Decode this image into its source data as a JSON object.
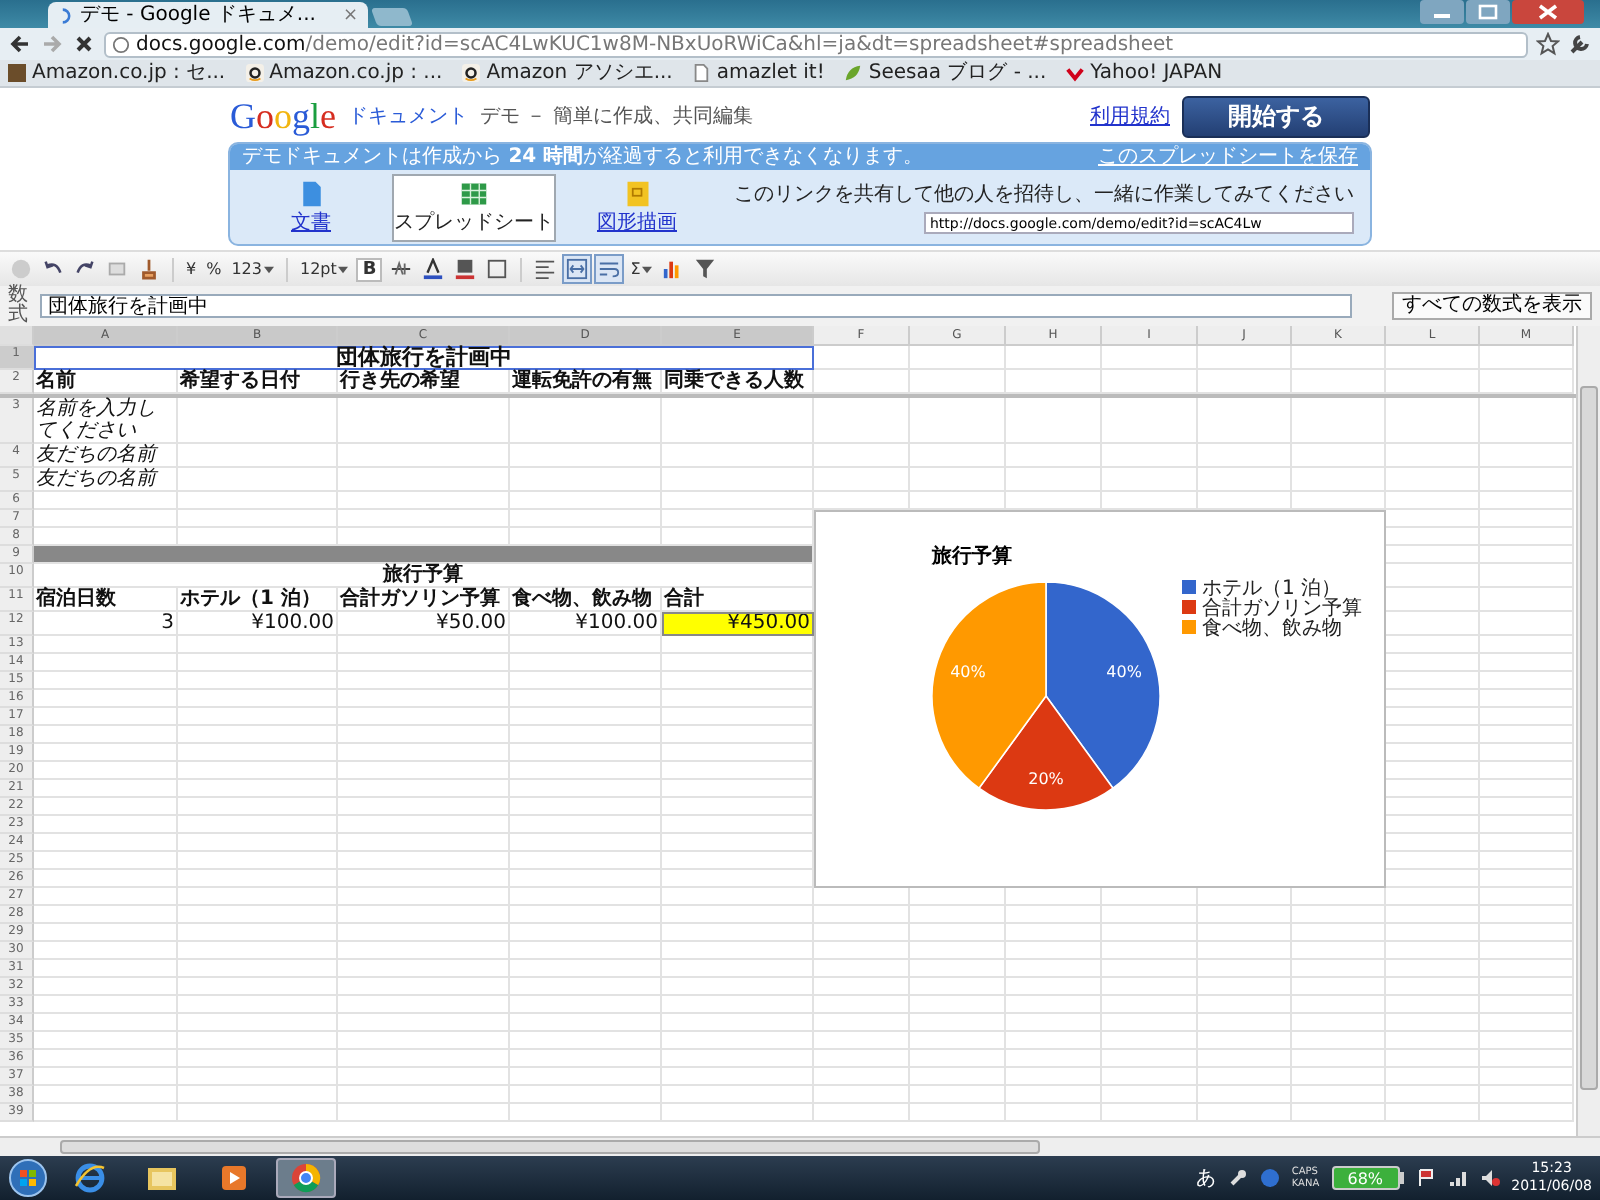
{
  "browser": {
    "tab": {
      "title": "デモ - Google ドキュメ...",
      "close": "×"
    },
    "address": {
      "host": "docs.google.com",
      "path": "/demo/edit?id=scAC4LwKUC1w8M-NBxUoRWiCa&hl=ja&dt=spreadsheet#spreadsheet"
    },
    "bookmarks": [
      {
        "label": "Amazon.co.jp : セ...",
        "kind": "photo"
      },
      {
        "label": "Amazon.co.jp : ...",
        "kind": "amazon"
      },
      {
        "label": "Amazon アソシエ...",
        "kind": "amazon"
      },
      {
        "label": "amazlet it!",
        "kind": "page"
      },
      {
        "label": "Seesaa ブログ - ...",
        "kind": "seesaa"
      },
      {
        "label": "Yahoo! JAPAN",
        "kind": "yahoo"
      }
    ]
  },
  "header": {
    "logo": "Google",
    "product": "ドキュメント",
    "tagline": "デモ － 簡単に作成、共同編集",
    "terms_link": "利用規約",
    "start_button": "開始する",
    "notice": "デモドキュメントは作成から **24 時間**が経過すると利用できなくなります。",
    "save_link": "このスプレッドシートを保存",
    "doc_types": [
      {
        "label": "文書",
        "kind": "document",
        "selected": false
      },
      {
        "label": "スプレッドシート",
        "kind": "spreadsheet",
        "selected": true
      },
      {
        "label": "図形描画",
        "kind": "drawing",
        "selected": false
      }
    ],
    "share_text": "このリンクを共有して他の人を招待し、一緒に作業してみてください",
    "share_url": "http://docs.google.com/demo/edit?id=scAC4Lw"
  },
  "toolbar": {
    "currency": "¥",
    "percent": "%",
    "number_format": "123",
    "font_size": "12pt",
    "bold": "B",
    "sum": "Σ",
    "merge_cells": {
      "on": true
    },
    "wrap_text": {
      "on": true
    }
  },
  "formula_bar": {
    "label": "数式",
    "value": "団体旅行を計画中",
    "show_all_button": "すべての数式を表示"
  },
  "sheet": {
    "columns": [
      {
        "label": "A",
        "selected": true
      },
      {
        "label": "B",
        "selected": true
      },
      {
        "label": "C",
        "selected": true
      },
      {
        "label": "D",
        "selected": true
      },
      {
        "label": "E",
        "selected": true
      },
      {
        "label": "F",
        "selected": false
      },
      {
        "label": "G",
        "selected": false
      },
      {
        "label": "H",
        "selected": false
      },
      {
        "label": "I",
        "selected": false
      },
      {
        "label": "J",
        "selected": false
      },
      {
        "label": "K",
        "selected": false
      },
      {
        "label": "L",
        "selected": false
      },
      {
        "label": "M",
        "selected": false
      }
    ],
    "rows": [
      {
        "number": "1",
        "kind": "merged",
        "text": "団体旅行を計画中",
        "selected": true
      },
      {
        "number": "2",
        "kind": "cells",
        "bold": true,
        "divider_below": true,
        "cells": [
          "名前",
          "希望する日付",
          "行き先の希望",
          "運転免許の有無",
          "同乗できる人数"
        ]
      },
      {
        "number": "3",
        "kind": "cells",
        "italic": true,
        "cells": [
          "名前を入力してください"
        ]
      },
      {
        "number": "4",
        "kind": "cells",
        "italic": true,
        "cells": [
          "友だちの名前"
        ]
      },
      {
        "number": "5",
        "kind": "cells",
        "italic": true,
        "cells": [
          "友だちの名前"
        ]
      },
      {
        "number": "6",
        "kind": "empty"
      },
      {
        "number": "7",
        "kind": "empty"
      },
      {
        "number": "8",
        "kind": "empty"
      },
      {
        "number": "9",
        "kind": "band"
      },
      {
        "number": "10",
        "kind": "merged",
        "text": "旅行予算",
        "selected": false
      },
      {
        "number": "11",
        "kind": "cells",
        "bold": true,
        "cells": [
          "宿泊日数",
          "ホテル（1 泊）",
          "合計ガソリン予算",
          "食べ物、飲み物",
          "合計"
        ]
      },
      {
        "number": "12",
        "kind": "cells",
        "right_aligned": true,
        "cells": [
          {
            "text": "3",
            "highlighted": false
          },
          {
            "text": "¥100.00",
            "highlighted": false
          },
          {
            "text": "¥50.00",
            "highlighted": false
          },
          {
            "text": "¥100.00",
            "highlighted": false
          },
          {
            "text": "¥450.00",
            "highlighted": true
          }
        ]
      },
      {
        "number": "13",
        "kind": "empty"
      },
      {
        "number": "14",
        "kind": "empty"
      },
      {
        "number": "15",
        "kind": "empty"
      },
      {
        "number": "16",
        "kind": "empty"
      },
      {
        "number": "17",
        "kind": "empty"
      },
      {
        "number": "18",
        "kind": "empty"
      },
      {
        "number": "19",
        "kind": "empty"
      },
      {
        "number": "20",
        "kind": "empty"
      },
      {
        "number": "21",
        "kind": "empty"
      },
      {
        "number": "22",
        "kind": "empty"
      },
      {
        "number": "23",
        "kind": "empty"
      },
      {
        "number": "24",
        "kind": "empty"
      },
      {
        "number": "25",
        "kind": "empty"
      },
      {
        "number": "26",
        "kind": "empty"
      },
      {
        "number": "27",
        "kind": "empty"
      },
      {
        "number": "28",
        "kind": "empty"
      },
      {
        "number": "29",
        "kind": "empty"
      },
      {
        "number": "30",
        "kind": "empty"
      },
      {
        "number": "31",
        "kind": "empty"
      },
      {
        "number": "32",
        "kind": "empty"
      },
      {
        "number": "33",
        "kind": "empty"
      },
      {
        "number": "34",
        "kind": "empty"
      },
      {
        "number": "35",
        "kind": "empty"
      },
      {
        "number": "36",
        "kind": "empty"
      },
      {
        "number": "37",
        "kind": "empty"
      },
      {
        "number": "38",
        "kind": "empty"
      },
      {
        "number": "39",
        "kind": "empty"
      }
    ],
    "chart_data": {
      "type": "pie",
      "title": "旅行予算",
      "categories": [
        "ホテル（1 泊）",
        "合計ガソリン予算",
        "食べ物、飲み物"
      ],
      "values": [
        40,
        20,
        40
      ],
      "value_labels": [
        "40%",
        "20%",
        "40%"
      ],
      "legend": "right"
    }
  },
  "taskbar": {
    "apps": [
      {
        "kind": "ie",
        "selected": false
      },
      {
        "kind": "folder",
        "selected": false
      },
      {
        "kind": "media",
        "selected": false
      },
      {
        "kind": "chrome",
        "selected": true
      }
    ],
    "ime": "あ",
    "caps": "CAPS",
    "kana": "KANA",
    "battery": "68%",
    "time": "15:23",
    "date": "2011/06/08"
  }
}
